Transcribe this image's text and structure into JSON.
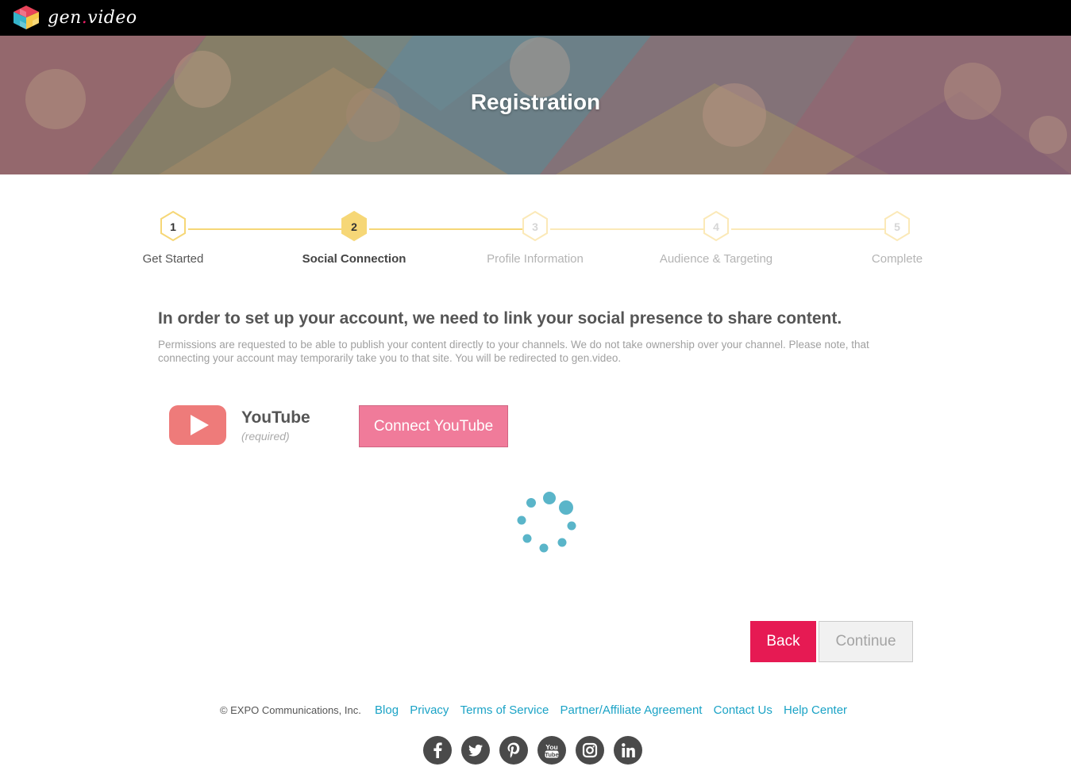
{
  "brand": {
    "logo_text": "gen",
    "logo_dot": ".",
    "logo_text2": "video"
  },
  "hero": {
    "title": "Registration"
  },
  "stepper": {
    "steps": [
      {
        "number": "1",
        "label": "Get Started",
        "state": "done"
      },
      {
        "number": "2",
        "label": "Social Connection",
        "state": "active"
      },
      {
        "number": "3",
        "label": "Profile Information",
        "state": "todo"
      },
      {
        "number": "4",
        "label": "Audience & Targeting",
        "state": "todo"
      },
      {
        "number": "5",
        "label": "Complete",
        "state": "todo"
      }
    ]
  },
  "content": {
    "heading": "In order to set up your account, we need to link your social presence to share content.",
    "subtext": "Permissions are requested to be able to publish your content directly to your channels. We do not take ownership over your channel. Please note, that connecting your account may temporarily take you to that site. You will be redirected to gen.video.",
    "youtube": {
      "name": "YouTube",
      "required": "(required)",
      "connect_label": "Connect YouTube"
    }
  },
  "actions": {
    "back_label": "Back",
    "continue_label": "Continue"
  },
  "footer": {
    "copyright": "© EXPO Communications, Inc.",
    "links": [
      "Blog",
      "Privacy",
      "Terms of Service",
      "Partner/Affiliate Agreement",
      "Contact Us",
      "Help Center"
    ],
    "socials": [
      "facebook-icon",
      "twitter-icon",
      "pinterest-icon",
      "youtube-icon",
      "instagram-icon",
      "linkedin-icon"
    ]
  },
  "colors": {
    "accent": "#e61a53",
    "connect": "#f07b9a",
    "link": "#1ba3c6",
    "step": "#f6d777",
    "spinner": "#5ab5c9"
  }
}
